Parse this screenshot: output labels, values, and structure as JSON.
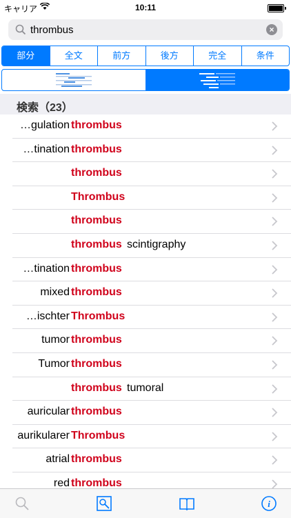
{
  "status": {
    "carrier": "キャリア",
    "time": "10:11"
  },
  "search": {
    "value": "thrombus"
  },
  "tabs": [
    {
      "label": "部分",
      "active": true
    },
    {
      "label": "全文",
      "active": false
    },
    {
      "label": "前方",
      "active": false
    },
    {
      "label": "後方",
      "active": false
    },
    {
      "label": "完全",
      "active": false
    },
    {
      "label": "条件",
      "active": false
    }
  ],
  "alignment": {
    "selected": "center"
  },
  "section": {
    "title": "検索（23）"
  },
  "results": [
    {
      "pre": "…gulation",
      "hit": "thrombus",
      "post": ""
    },
    {
      "pre": "…tination",
      "hit": "thrombus",
      "post": ""
    },
    {
      "pre": "",
      "hit": "thrombus",
      "post": ""
    },
    {
      "pre": "",
      "hit": "Thrombus",
      "post": ""
    },
    {
      "pre": "",
      "hit": "thrombus",
      "post": ""
    },
    {
      "pre": "",
      "hit": "thrombus",
      "post": "scintigraphy"
    },
    {
      "pre": "…tination",
      "hit": "thrombus",
      "post": ""
    },
    {
      "pre": "mixed",
      "hit": "thrombus",
      "post": ""
    },
    {
      "pre": "…ischter",
      "hit": "Thrombus",
      "post": ""
    },
    {
      "pre": "tumor",
      "hit": "thrombus",
      "post": ""
    },
    {
      "pre": "Tumor",
      "hit": "thrombus",
      "post": ""
    },
    {
      "pre": "",
      "hit": "thrombus",
      "post": "tumoral"
    },
    {
      "pre": "auricular",
      "hit": "thrombus",
      "post": ""
    },
    {
      "pre": "aurikularer",
      "hit": "Thrombus",
      "post": ""
    },
    {
      "pre": "atrial",
      "hit": "thrombus",
      "post": ""
    },
    {
      "pre": "red",
      "hit": "thrombus",
      "post": ""
    }
  ],
  "tabbar": [
    {
      "icon": "search-icon",
      "active": false
    },
    {
      "icon": "image-search-icon",
      "active": true
    },
    {
      "icon": "book-icon",
      "active": true
    },
    {
      "icon": "info-icon",
      "active": true
    }
  ],
  "colors": {
    "accent": "#007aff",
    "highlight": "#d0021b"
  }
}
